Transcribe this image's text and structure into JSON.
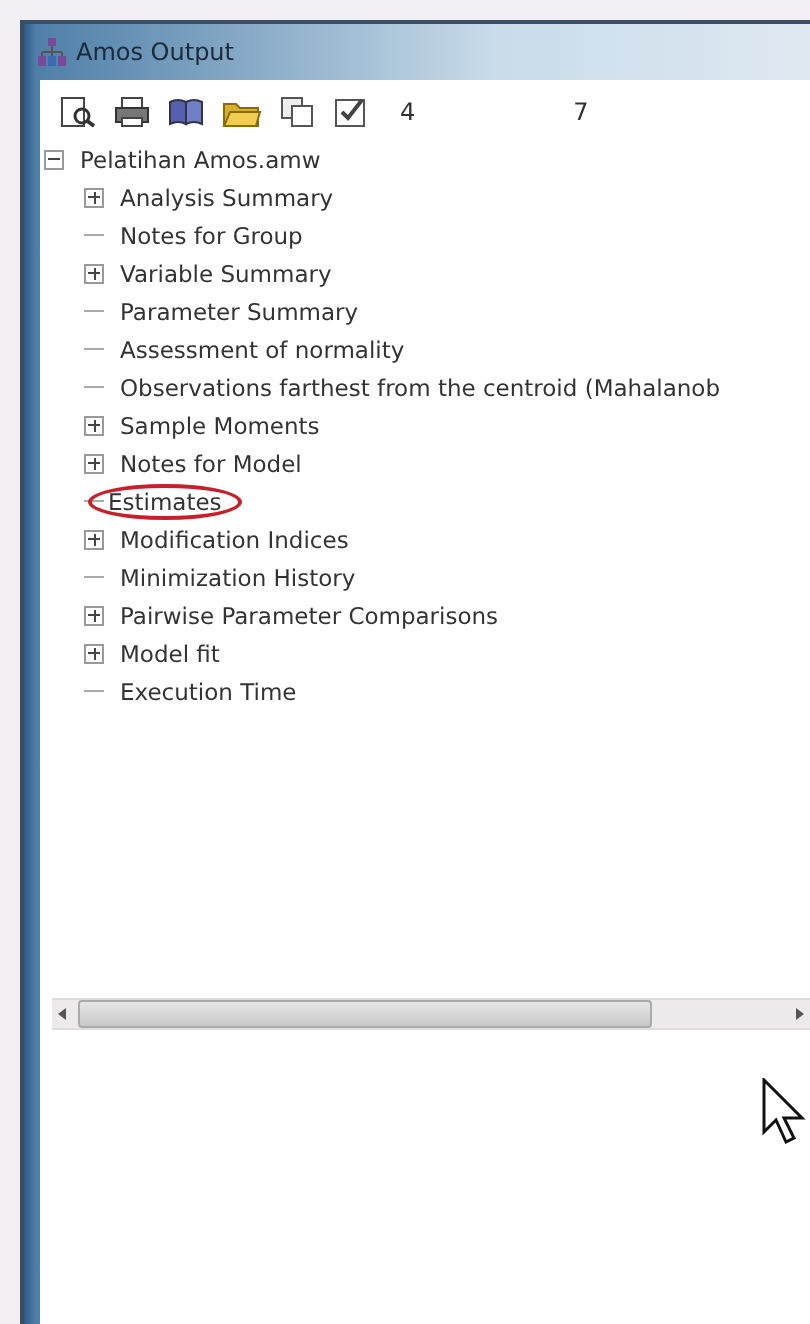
{
  "window": {
    "title": "Amos Output"
  },
  "toolbar": {
    "items": [
      {
        "kind": "preview"
      },
      {
        "kind": "print"
      },
      {
        "kind": "book"
      },
      {
        "kind": "folder"
      },
      {
        "kind": "copy"
      },
      {
        "kind": "options"
      },
      {
        "kind": "text",
        "label": "4"
      },
      {
        "kind": "text",
        "label": "7"
      }
    ]
  },
  "tree": {
    "label": "Pelatihan Amos.amw",
    "expanded": true,
    "children": [
      {
        "label": "Analysis Summary",
        "expandable": true,
        "circled": false
      },
      {
        "label": "Notes for Group",
        "expandable": false,
        "circled": false
      },
      {
        "label": "Variable Summary",
        "expandable": true,
        "circled": false
      },
      {
        "label": "Parameter Summary",
        "expandable": false,
        "circled": false
      },
      {
        "label": "Assessment of normality",
        "expandable": false,
        "circled": false
      },
      {
        "label": "Observations farthest from the centroid (Mahalanob",
        "expandable": false,
        "circled": false
      },
      {
        "label": "Sample Moments",
        "expandable": true,
        "circled": false
      },
      {
        "label": "Notes for Model",
        "expandable": true,
        "circled": false
      },
      {
        "label": "Estimates",
        "expandable": false,
        "circled": true
      },
      {
        "label": "Modification Indices",
        "expandable": true,
        "circled": false
      },
      {
        "label": "Minimization History",
        "expandable": false,
        "circled": false
      },
      {
        "label": "Pairwise Parameter Comparisons",
        "expandable": true,
        "circled": false
      },
      {
        "label": "Model fit",
        "expandable": true,
        "circled": false
      },
      {
        "label": "Execution Time",
        "expandable": false,
        "circled": false
      }
    ]
  }
}
